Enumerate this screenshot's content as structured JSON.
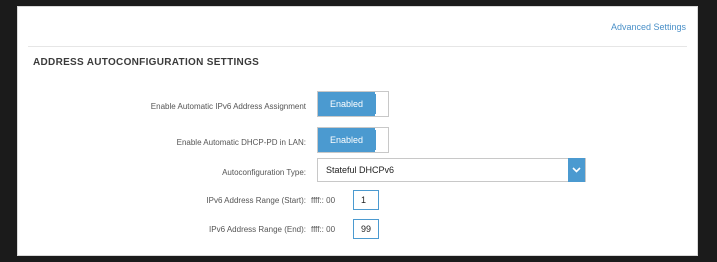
{
  "header": {
    "advanced_settings_link": "Advanced Settings"
  },
  "section": {
    "title": "ADDRESS AUTOCONFIGURATION SETTINGS"
  },
  "rows": {
    "auto_ipv6": {
      "label": "Enable Automatic IPv6 Address Assignment",
      "value": "Enabled"
    },
    "auto_dhcp_pd": {
      "label": "Enable Automatic DHCP-PD in LAN:",
      "value": "Enabled"
    },
    "autoconfig_type": {
      "label": "Autoconfiguration Type:",
      "value": "Stateful DHCPv6"
    },
    "range_start": {
      "label": "IPv6 Address Range (Start):",
      "prefix": "ffff:: 00",
      "value": "1"
    },
    "range_end": {
      "label": "IPv6 Address Range (End):",
      "prefix": "ffff:: 00",
      "value": "99"
    }
  },
  "colors": {
    "accent": "#4b9ad0",
    "link": "#4a90c8"
  },
  "icons": {
    "select_arrow": "chevron-down-icon"
  }
}
